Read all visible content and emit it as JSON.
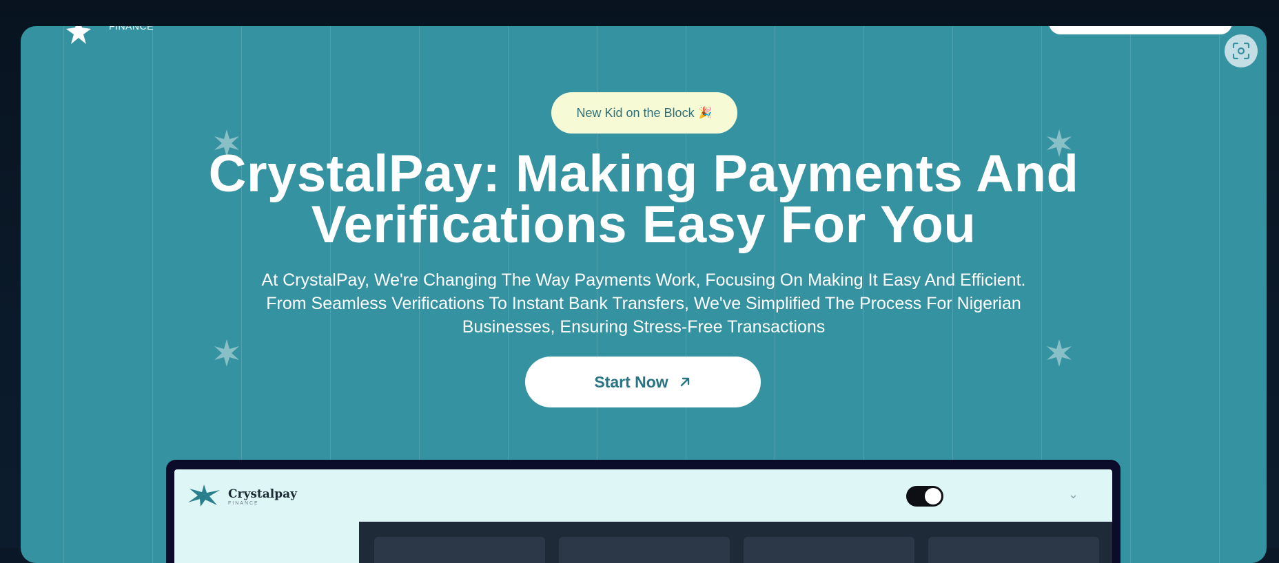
{
  "header": {
    "logo_subtext": "FINANCE"
  },
  "badge": {
    "label": "New Kid on the Block",
    "emoji": "🎉"
  },
  "hero": {
    "headline_line1": "CrystalPay: Making Payments And",
    "headline_line2": "Verifications Easy For You",
    "description_line1": "At CrystalPay, We're Changing The Way Payments Work, Focusing On Making It Easy And Efficient.",
    "description_line2": "From Seamless Verifications To Instant Bank Transfers, We've Simplified The Process For Nigerian",
    "description_line3": "Businesses, Ensuring Stress-Free Transactions"
  },
  "cta": {
    "label": "Start Now",
    "icon": "arrow-up-right-icon"
  },
  "preview": {
    "brand_name": "Crystalpay",
    "brand_sub": "FINANCE",
    "theme_toggle": "dark-mode-toggle",
    "dropdown_icon": "chevron-down-icon"
  },
  "colors": {
    "panel_bg": "#3592a0",
    "badge_bg": "#f6fbd6",
    "cta_text": "#267482",
    "page_bg": "#0a1726"
  }
}
